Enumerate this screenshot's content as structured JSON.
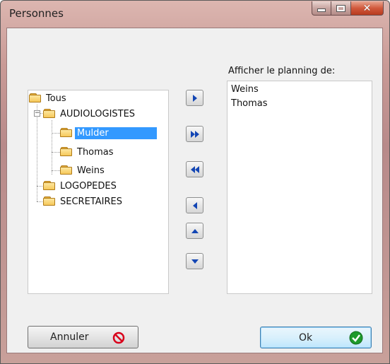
{
  "window": {
    "title": "Personnes"
  },
  "tree": {
    "items": [
      {
        "label": "Tous"
      },
      {
        "label": "AUDIOLOGISTES"
      },
      {
        "label": "Mulder"
      },
      {
        "label": "Thomas"
      },
      {
        "label": "Weins"
      },
      {
        "label": "LOGOPEDES"
      },
      {
        "label": "SECRETAIRES"
      }
    ],
    "selected": "Mulder"
  },
  "arrows": {
    "icons": [
      "arrow-right-icon",
      "double-arrow-right-icon",
      "double-arrow-left-icon",
      "arrow-left-icon",
      "arrow-up-icon",
      "arrow-down-icon"
    ]
  },
  "list": {
    "label": "Afficher le planning de:",
    "items": [
      "Weins",
      "Thomas"
    ]
  },
  "buttons": {
    "cancel_label": "Annuler",
    "ok_label": "Ok"
  },
  "colors": {
    "selection": "#3399ff",
    "arrow": "#1346b4",
    "cancel_icon": "#d9001b",
    "ok_icon": "#1e9a2c"
  }
}
